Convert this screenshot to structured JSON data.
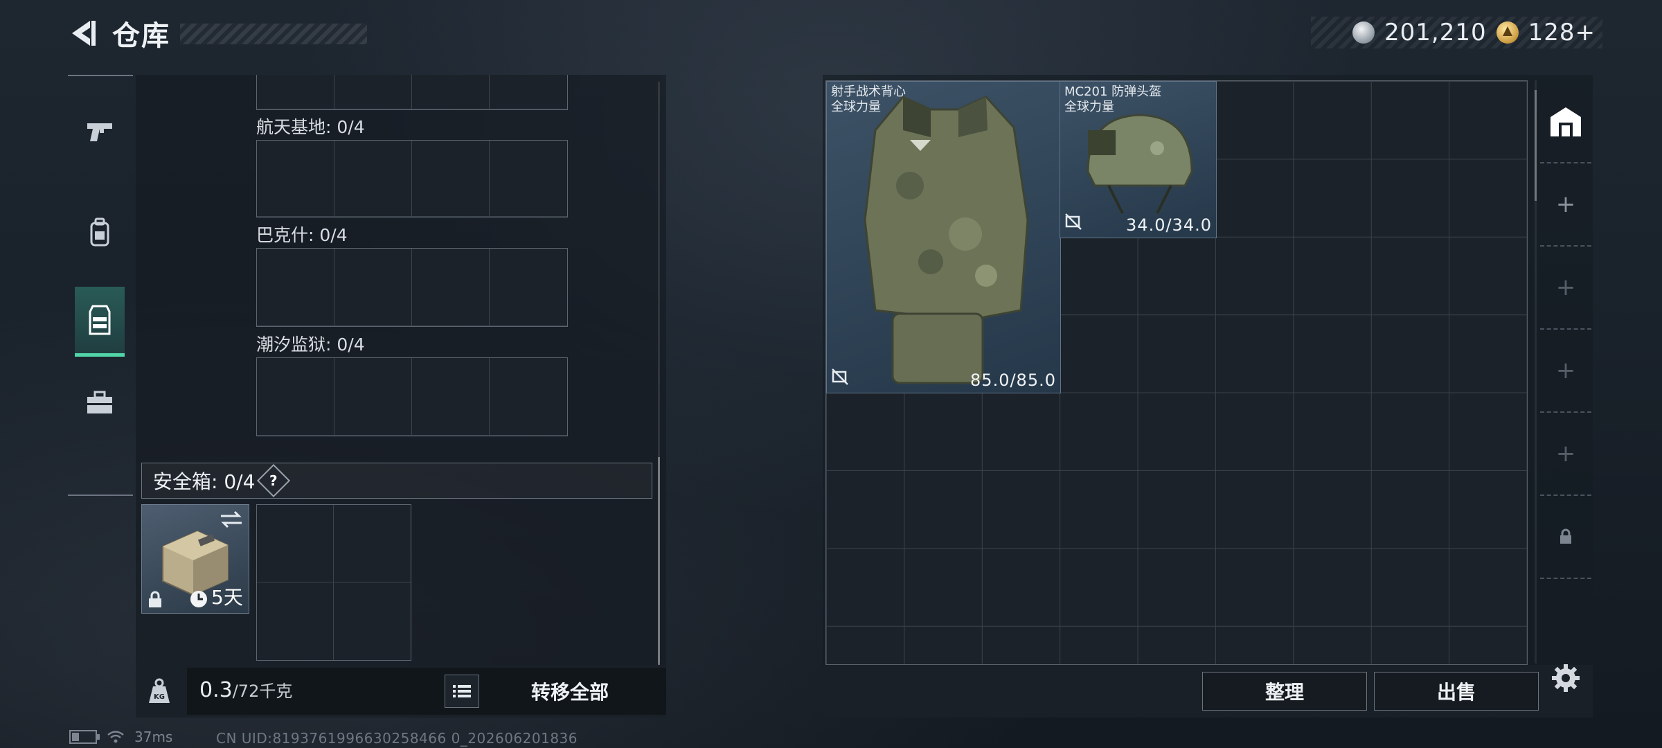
{
  "header": {
    "title": "仓库"
  },
  "currency": {
    "coins": "201,210",
    "tickets": "128+"
  },
  "left_rail": {
    "tabs": [
      {
        "icon": "pistol-icon",
        "active": false
      },
      {
        "icon": "backpack-icon",
        "active": false
      },
      {
        "icon": "armor-vest-icon",
        "active": true
      },
      {
        "icon": "toolbox-icon",
        "active": false
      }
    ]
  },
  "left_panel": {
    "locations": [
      {
        "label": "航天基地: 0/4"
      },
      {
        "label": "巴克什: 0/4"
      },
      {
        "label": "潮汐监狱: 0/4"
      }
    ],
    "safebox": {
      "title": "安全箱: 0/4",
      "help": "?",
      "duration": "5天"
    },
    "weight": {
      "current": "0.3",
      "capacity": "/72千克"
    },
    "transfer_all": "转移全部"
  },
  "stash": {
    "items": [
      {
        "name": "射手战术背心\n全球力量",
        "durability": "85.0/85.0"
      },
      {
        "name": "MC201 防弹头盔\n全球力量",
        "durability": "34.0/34.0"
      }
    ],
    "buttons": {
      "sort": "整理",
      "sell": "出售"
    }
  },
  "status": {
    "ping": "37ms",
    "uid": "CN UID:8193761996630258466 0_202606201836"
  },
  "colors": {
    "accent": "#52d6a8",
    "panel": "#1c2229"
  }
}
